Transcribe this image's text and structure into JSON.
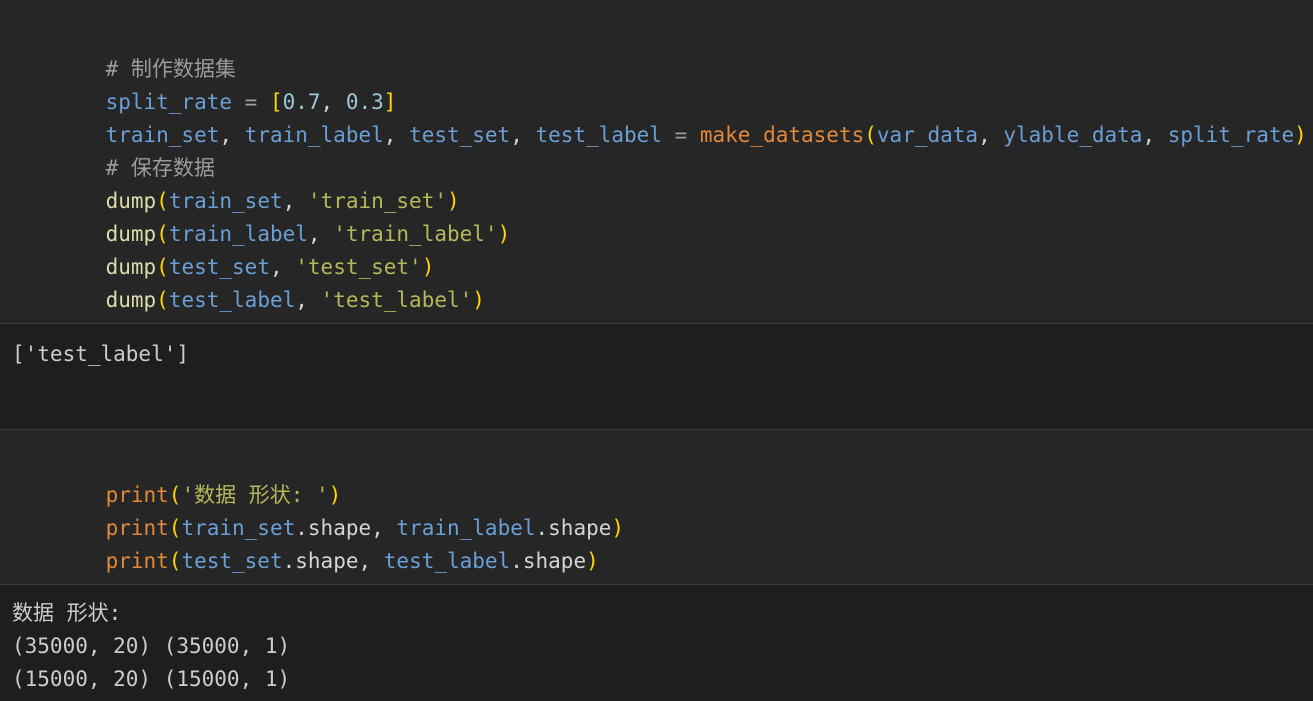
{
  "cell1": {
    "comment1": "# 制作数据集",
    "split_var": "split_rate",
    "split_vals": [
      "0.7",
      "0.3"
    ],
    "assign_vars": [
      "train_set",
      "train_label",
      "test_set",
      "test_label"
    ],
    "make_fn": "make_datasets",
    "make_args": [
      "var_data",
      "ylable_data",
      "split_rate"
    ],
    "comment2": "# 保存数据",
    "dump_fn": "dump",
    "dumps": [
      {
        "arg": "train_set",
        "name": "'train_set'"
      },
      {
        "arg": "train_label",
        "name": "'train_label'"
      },
      {
        "arg": "test_set",
        "name": "'test_set'"
      },
      {
        "arg": "test_label",
        "name": "'test_label'"
      }
    ]
  },
  "output1": {
    "text": "['test_label']"
  },
  "cell2": {
    "print_fn": "print",
    "print_str": "'数据 形状: '",
    "prop": "shape",
    "line2_vars": [
      "train_set",
      "train_label"
    ],
    "line3_vars": [
      "test_set",
      "test_label"
    ]
  },
  "output2": {
    "lines": [
      "数据 形状:",
      "(35000, 20) (35000, 1)",
      "(15000, 20) (15000, 1)"
    ]
  }
}
